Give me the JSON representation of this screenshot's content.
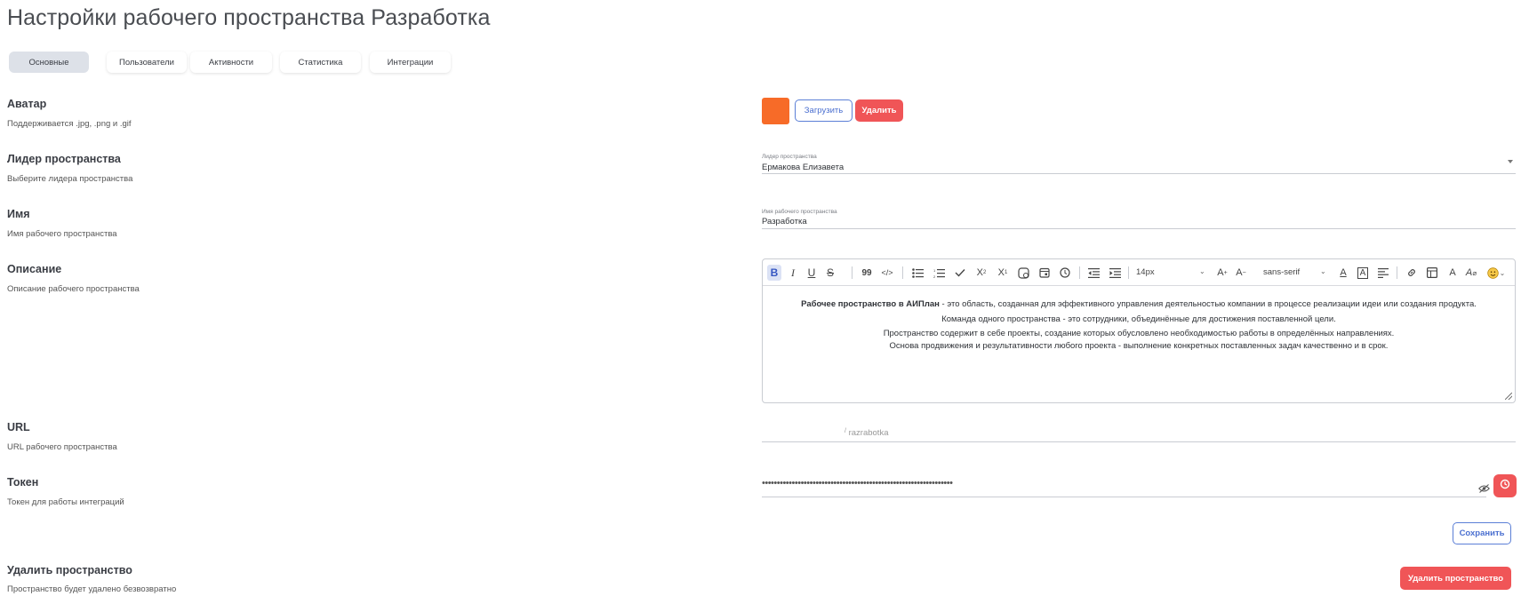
{
  "page": {
    "title": "Настройки рабочего пространства Разработка"
  },
  "tabs": [
    {
      "label": "Основные",
      "active": true
    },
    {
      "label": "Пользователи",
      "active": false
    },
    {
      "label": "Активности",
      "active": false
    },
    {
      "label": "Статистика",
      "active": false
    },
    {
      "label": "Интеграции",
      "active": false
    }
  ],
  "avatar": {
    "label": "Аватар",
    "hint": "Поддерживается .jpg, .png и .gif",
    "color": "#f76b28",
    "upload_label": "Загрузить",
    "delete_label": "Удалить"
  },
  "leader": {
    "label": "Лидер пространства",
    "hint": "Выберите лидера пространства",
    "field_label": "Лидер пространства",
    "value": "Ермакова Елизавета"
  },
  "name": {
    "label": "Имя",
    "hint": "Имя рабочего пространства",
    "field_label": "Имя рабочего пространства",
    "value": "Разработка"
  },
  "description": {
    "label": "Описание",
    "hint": "Описание рабочего пространства",
    "toolbar": {
      "font_size": "14px",
      "font_family": "sans-serif"
    },
    "content": {
      "line1_bold": "Рабочее пространство в АИПлан",
      "line1_rest": " - это область, созданная для эффективного управления деятельностью компании в процессе реализации идеи или создания продукта.",
      "line2": "Команда одного пространства - это сотрудники, объединённые для достижения поставленной цели.",
      "line3": "Пространство содержит в себе проекты, создание которых обусловлено необходимостью работы в определённых направлениях.",
      "line4": "Основа продвижения и результативности любого проекта - выполнение конкретных поставленных задач качественно и в срок."
    }
  },
  "url": {
    "label": "URL",
    "hint": "URL рабочего пространства",
    "prefix": "/",
    "value": "razrabotka"
  },
  "token": {
    "label": "Токен",
    "hint": "Токен для работы интеграций",
    "masked_value": "••••••••••••••••••••••••••••••••••••••••••••••••••••••••••••••••"
  },
  "actions": {
    "save_label": "Сохранить"
  },
  "delete_space": {
    "label": "Удалить пространство",
    "hint": "Пространство будет удалено безвозвратно",
    "button_label": "Удалить пространство"
  },
  "colors": {
    "accent_blue": "#4a6fd0",
    "danger_red": "#f05557",
    "avatar_orange": "#f76b28"
  }
}
